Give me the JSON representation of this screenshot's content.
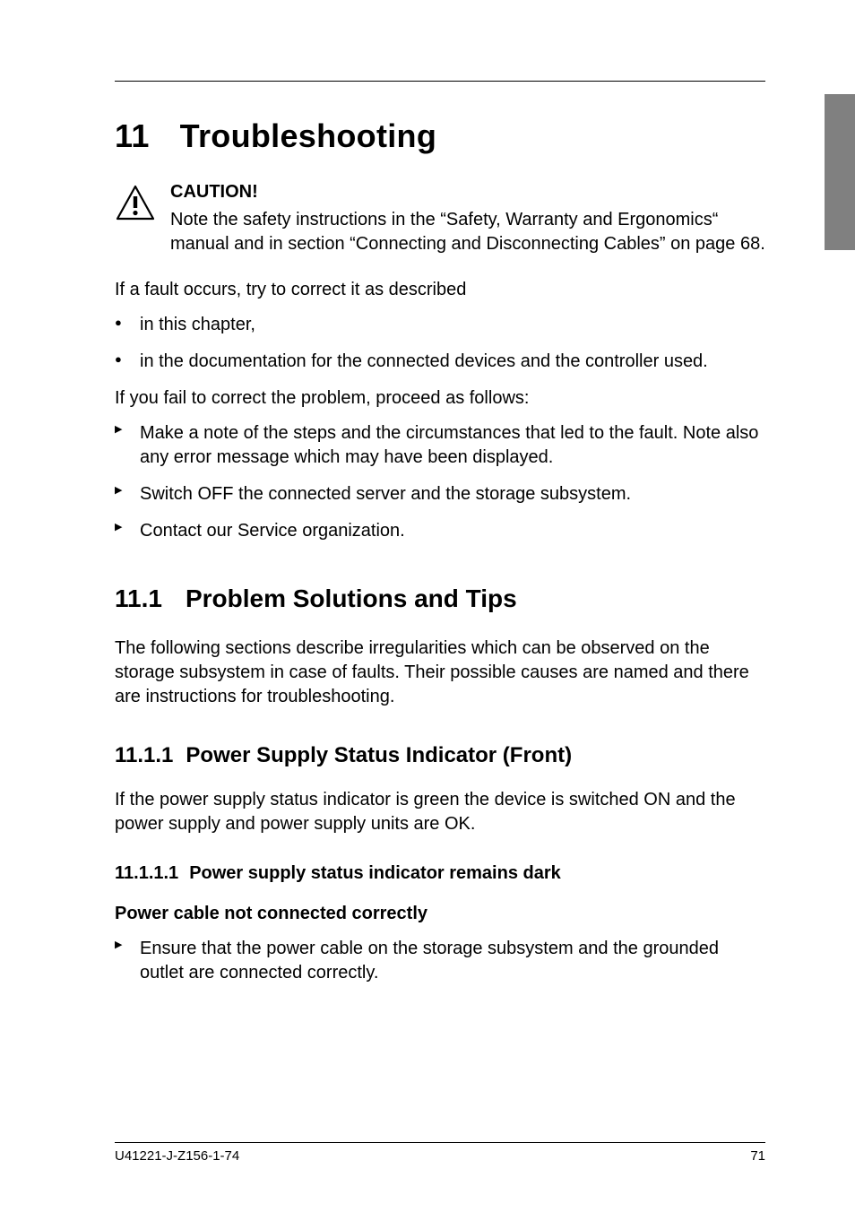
{
  "chapter": {
    "number": "11",
    "title": "Troubleshooting"
  },
  "caution": {
    "label": "CAUTION!",
    "body": "Note the safety instructions in the “Safety, Warranty and Ergonomics“ manual and in section “Connecting and Disconnecting Cables” on page 68."
  },
  "intro_para1": "If a fault occurs, try to correct it as described",
  "bullets1": [
    "in this chapter,",
    "in the documentation for the connected devices and the controller used."
  ],
  "intro_para2": "If you fail to correct the problem, proceed as follows:",
  "arrows1": [
    "Make a note of the steps and the circumstances that led to the fault. Note also any error message which may have been displayed.",
    "Switch OFF the connected server and the storage subsystem.",
    "Contact our Service organization."
  ],
  "section": {
    "number": "11.1",
    "title": "Problem Solutions and Tips",
    "intro": "The following sections describe irregularities which can be observed on the storage subsystem in case of faults. Their possible causes are named and there are instructions for troubleshooting."
  },
  "subsection": {
    "number": "11.1.1",
    "title": "Power Supply Status Indicator (Front)",
    "intro": "If the power supply status indicator is green the device is switched ON and the power supply and power supply units are OK."
  },
  "subsubsection": {
    "number": "11.1.1.1",
    "title": "Power supply status indicator remains dark"
  },
  "cause1": {
    "heading": "Power cable not connected correctly",
    "step": "Ensure that the power cable on the storage subsystem and the grounded outlet are connected correctly."
  },
  "footer": {
    "doc_id": "U41221-J-Z156-1-74",
    "page": "71"
  }
}
